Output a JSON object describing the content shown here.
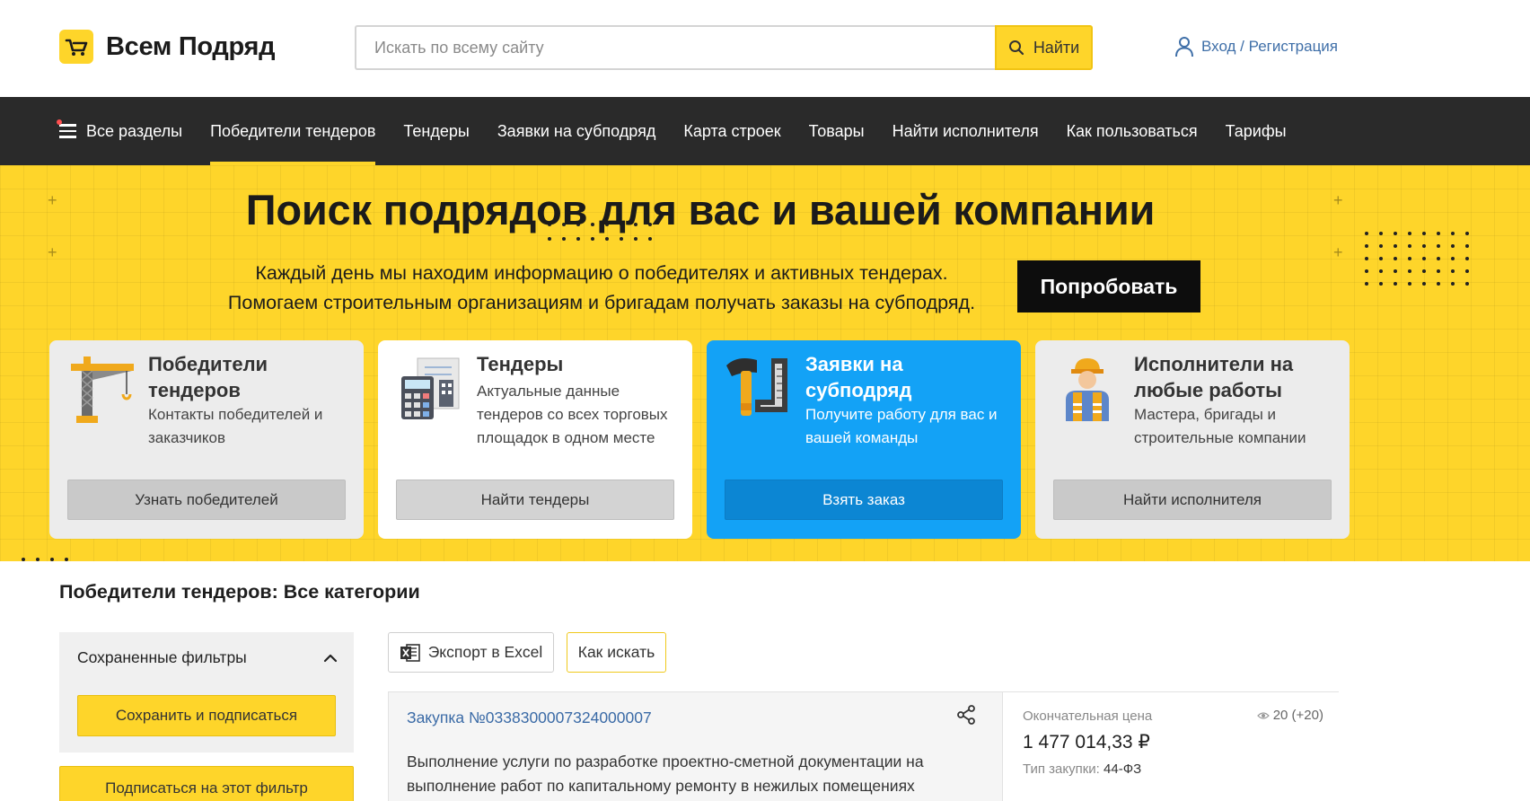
{
  "header": {
    "logo_text": "Всем Подряд",
    "search_placeholder": "Искать по всему сайту",
    "search_button": "Найти",
    "login_link": "Вход / Регистрация"
  },
  "nav": {
    "all_sections": "Все разделы",
    "items": [
      "Победители тендеров",
      "Тендеры",
      "Заявки на субподряд",
      "Карта строек",
      "Товары",
      "Найти исполнителя",
      "Как пользоваться",
      "Тарифы"
    ]
  },
  "hero": {
    "title": "Поиск подрядов для вас и вашей компании",
    "subtitle_line1": "Каждый день мы находим информацию о победителях и активных тендерах.",
    "subtitle_line2": "Помогаем строительным организациям и бригадам получать заказы на субподряд.",
    "try_button": "Попробовать"
  },
  "cards": [
    {
      "title": "Победители тендеров",
      "desc": "Контакты победителей и заказчиков",
      "button": "Узнать победителей",
      "icon": "crane-icon"
    },
    {
      "title": "Тендеры",
      "desc": "Актуальные данные тендеров со всех торговых площадок в одном месте",
      "button": "Найти тендеры",
      "icon": "calculator-icon"
    },
    {
      "title": "Заявки на субподряд",
      "desc": "Получите работу для вас и вашей команды",
      "button": "Взять заказ",
      "icon": "hammer-ruler-icon"
    },
    {
      "title": "Исполнители на любые работы",
      "desc": "Мастера, бригады и строительные компании",
      "button": "Найти исполнителя",
      "icon": "worker-icon"
    }
  ],
  "content": {
    "section_title": "Победители тендеров: Все категории",
    "filters_title": "Сохраненные фильтры",
    "save_button": "Сохранить и подписаться",
    "subscribe_button": "Подписаться на этот фильтр",
    "export_button": "Экспорт в Excel",
    "how_button": "Как искать"
  },
  "result": {
    "link": "Закупка №0338300007324000007",
    "desc": "Выполнение услуги по разработке проектно-сметной документации на выполнение работ по капитальному ремонту в нежилых помещениях здания с",
    "price_label": "Окончательная цена",
    "price": "1 477 014,33 ₽",
    "type_label": "Тип закупки:",
    "type_value": "44-ФЗ",
    "views": "20 (+20)"
  }
}
